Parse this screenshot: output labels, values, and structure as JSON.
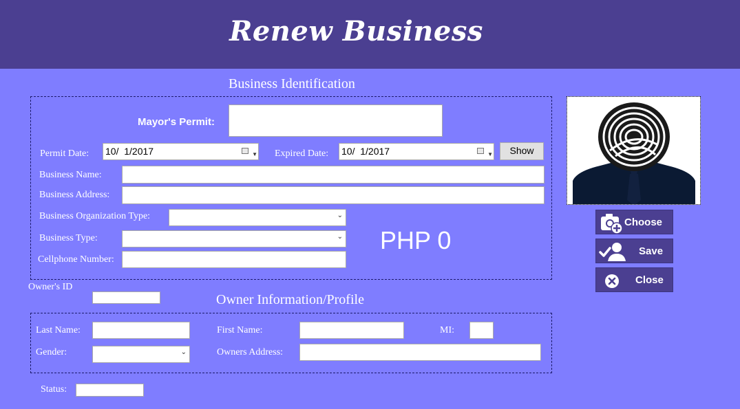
{
  "header": {
    "title": "Renew Business"
  },
  "business": {
    "section_title": "Business Identification",
    "mayors_permit_label": "Mayor's Permit:",
    "mayors_permit_value": "",
    "permit_date_label": "Permit Date:",
    "permit_date_value": "10/  1/2017",
    "expired_date_label": "Expired Date:",
    "expired_date_value": "10/  1/2017",
    "show_label": "Show",
    "name_label": "Business Name:",
    "address_label": "Business Address:",
    "org_type_label": "Business Organization Type:",
    "type_label": "Business Type:",
    "cellphone_label": "Cellphone Number:",
    "amount_display": "PHP 0"
  },
  "owner": {
    "id_label": "Owner's ID",
    "section_title": "Owner Information/Profile",
    "last_name_label": "Last Name:",
    "first_name_label": "First Name:",
    "mi_label": "MI:",
    "gender_label": "Gender:",
    "address_label": "Owners Address:"
  },
  "status": {
    "label": "Status:"
  },
  "side": {
    "choose_label": "Choose",
    "save_label": "Save",
    "close_label": "Close"
  },
  "icons": {
    "choose": "camera-plus-icon",
    "save": "user-check-icon",
    "close": "close-circle-icon",
    "photo": "fingerprint-avatar-icon"
  },
  "colors": {
    "background": "#7f7dff",
    "header": "#4b3f91",
    "button": "#4b3f91"
  }
}
